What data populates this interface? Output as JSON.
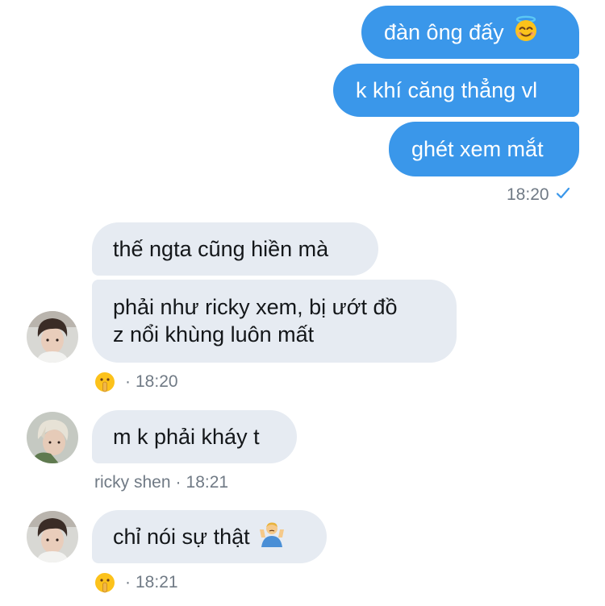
{
  "messages": {
    "sent": [
      {
        "text": "đàn ông đấy",
        "emoji": "smiling-face-with-halo-icon"
      },
      {
        "text": "k khí căng thẳng vl"
      },
      {
        "text": "ghét xem mắt"
      }
    ],
    "sent_time": "18:20",
    "received_group1": {
      "msg1": "thế ngta cũng hiền mà",
      "msg2_line1": "phải như ricky xem, bị ướt đồ",
      "msg2_line2": "z nổi khùng luôn mất",
      "reaction_icon": "shushing-face-icon",
      "separator": "·",
      "time": "18:20"
    },
    "received_group2": {
      "msg": "m k phải kháy t",
      "sender": "ricky shen",
      "separator": "·",
      "time": "18:21"
    },
    "received_group3": {
      "msg": "chỉ nói sự thật",
      "emoji": "person-shrugging-icon",
      "reaction_icon": "shushing-face-icon",
      "separator": "·",
      "time": "18:21"
    }
  },
  "colors": {
    "sent_bubble": "#3a97ea",
    "received_bubble": "#e6ebf2",
    "meta_text": "#707a85",
    "read_check": "#3a97ea"
  }
}
